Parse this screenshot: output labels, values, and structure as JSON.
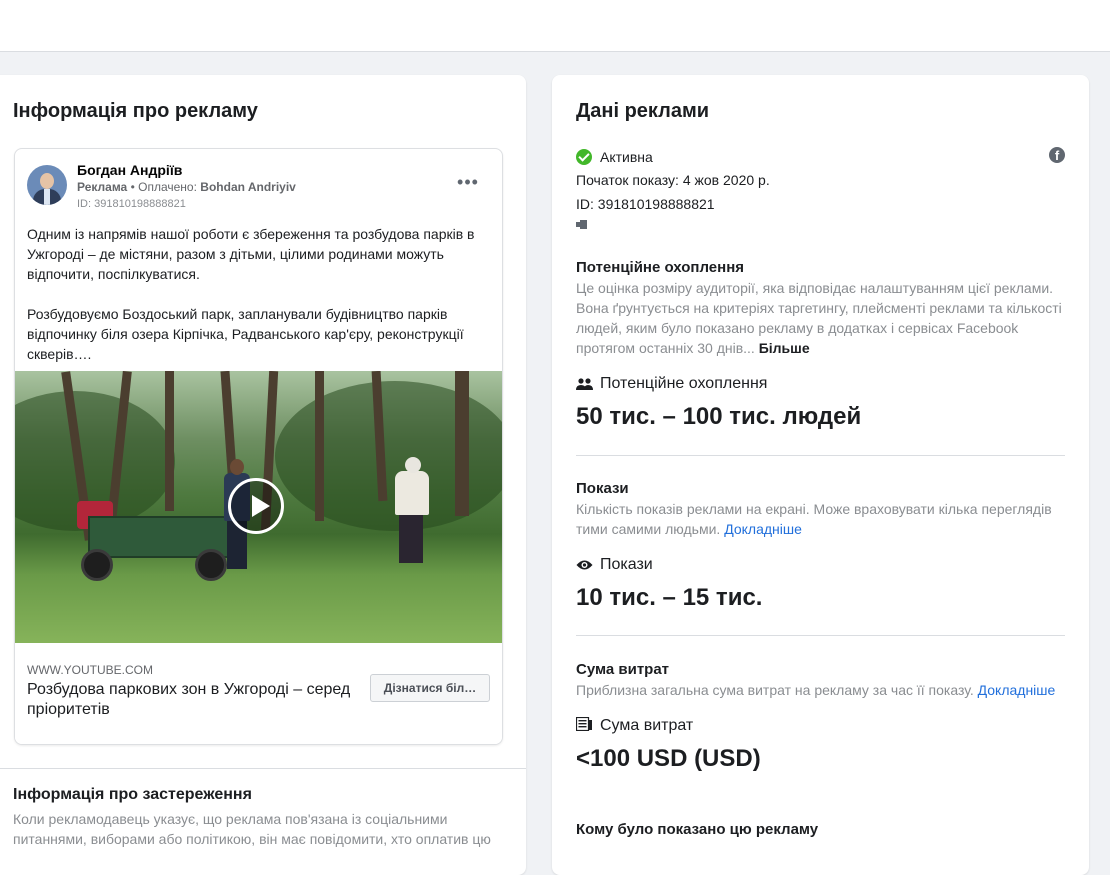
{
  "ad_info": {
    "title": "Інформація про рекламу",
    "ad": {
      "poster_name": "Богдан Андріїв",
      "sponsored_label": "Реклама",
      "paid_label": "Оплачено:",
      "paid_by": "Bohdan Andriyiv",
      "id_line": "ID: 391810198888821",
      "more_icon": "more-horizontal-icon",
      "text": "Одним із напрямів нашої роботи є збереження та розбудова парків в Ужгороді – де містяни, разом з дітьми, цілими родинами можуть відпочити, поспілкуватися.\n\nРозбудовуємо Боздоський парк, запланували будівництво парків відпочинку біля озера Кірпічка, Радванського кар'єру, реконструкції скверів….",
      "link_domain": "WWW.YOUTUBE.COM",
      "link_title": "Розбудова паркових зон в Ужгороді – серед пріоритетів",
      "cta_label": "Дізнатися біл…"
    },
    "disclaimer": {
      "title": "Інформація про застереження",
      "text": "Коли рекламодавець указує, що реклама пов'язана із соціальними питаннями, виборами або політикою, він має повідомити, хто оплатив цю"
    }
  },
  "ad_data": {
    "title": "Дані реклами",
    "status": "Активна",
    "status_color": "#42b72a",
    "start_line": "Початок показу: 4 жов 2020 р.",
    "id_line": "ID: 391810198888821",
    "reach": {
      "title": "Потенційне охоплення",
      "desc": "Це оцінка розміру аудиторії, яка відповідає налаштуванням цієї реклами. Вона ґрунтується на критеріях таргетингу, плейсменті реклами та кількості людей, яким було показано рекламу в додатках і сервісах Facebook протягом останніх 30 днів...",
      "more": "Більше",
      "metric_label": "Потенційне охоплення",
      "metric_value": "50 тис. – 100 тис. людей"
    },
    "impressions": {
      "title": "Покази",
      "desc": "Кількість показів реклами на екрані. Може враховувати кілька переглядів тими самими людьми.",
      "link": "Докладніше",
      "metric_label": "Покази",
      "metric_value": "10 тис. – 15 тис."
    },
    "spend": {
      "title": "Сума витрат",
      "desc": "Приблизна загальна сума витрат на рекламу за час її показу.",
      "link": "Докладніше",
      "metric_label": "Сума витрат",
      "metric_value": "<100 USD (USD)"
    },
    "audience_title": "Кому було показано цю рекламу"
  }
}
